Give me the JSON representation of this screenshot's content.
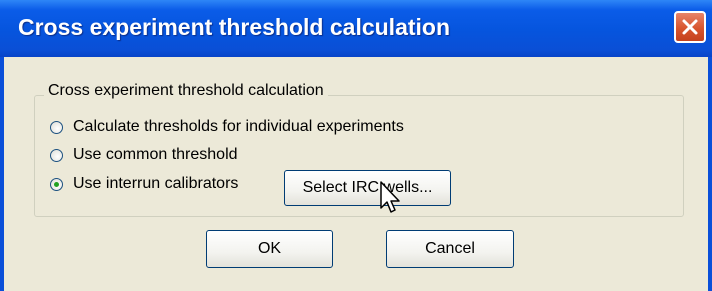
{
  "dialog": {
    "title": "Cross experiment threshold calculation"
  },
  "group": {
    "legend": "Cross experiment threshold calculation",
    "options": [
      {
        "label": "Calculate thresholds for individual experiments",
        "selected": false
      },
      {
        "label": "Use common threshold",
        "selected": false
      },
      {
        "label": "Use interrun calibrators",
        "selected": true
      }
    ],
    "select_irc_label": "Select IRC wells..."
  },
  "buttons": {
    "ok_label": "OK",
    "cancel_label": "Cancel"
  },
  "icons": {
    "close": "close-icon",
    "cursor": "mouse-pointer-icon"
  },
  "colors": {
    "title_bar": "#0655de",
    "close_button": "#d8552e",
    "dialog_background": "#ece9d8",
    "radio_selected": "#21a121"
  }
}
